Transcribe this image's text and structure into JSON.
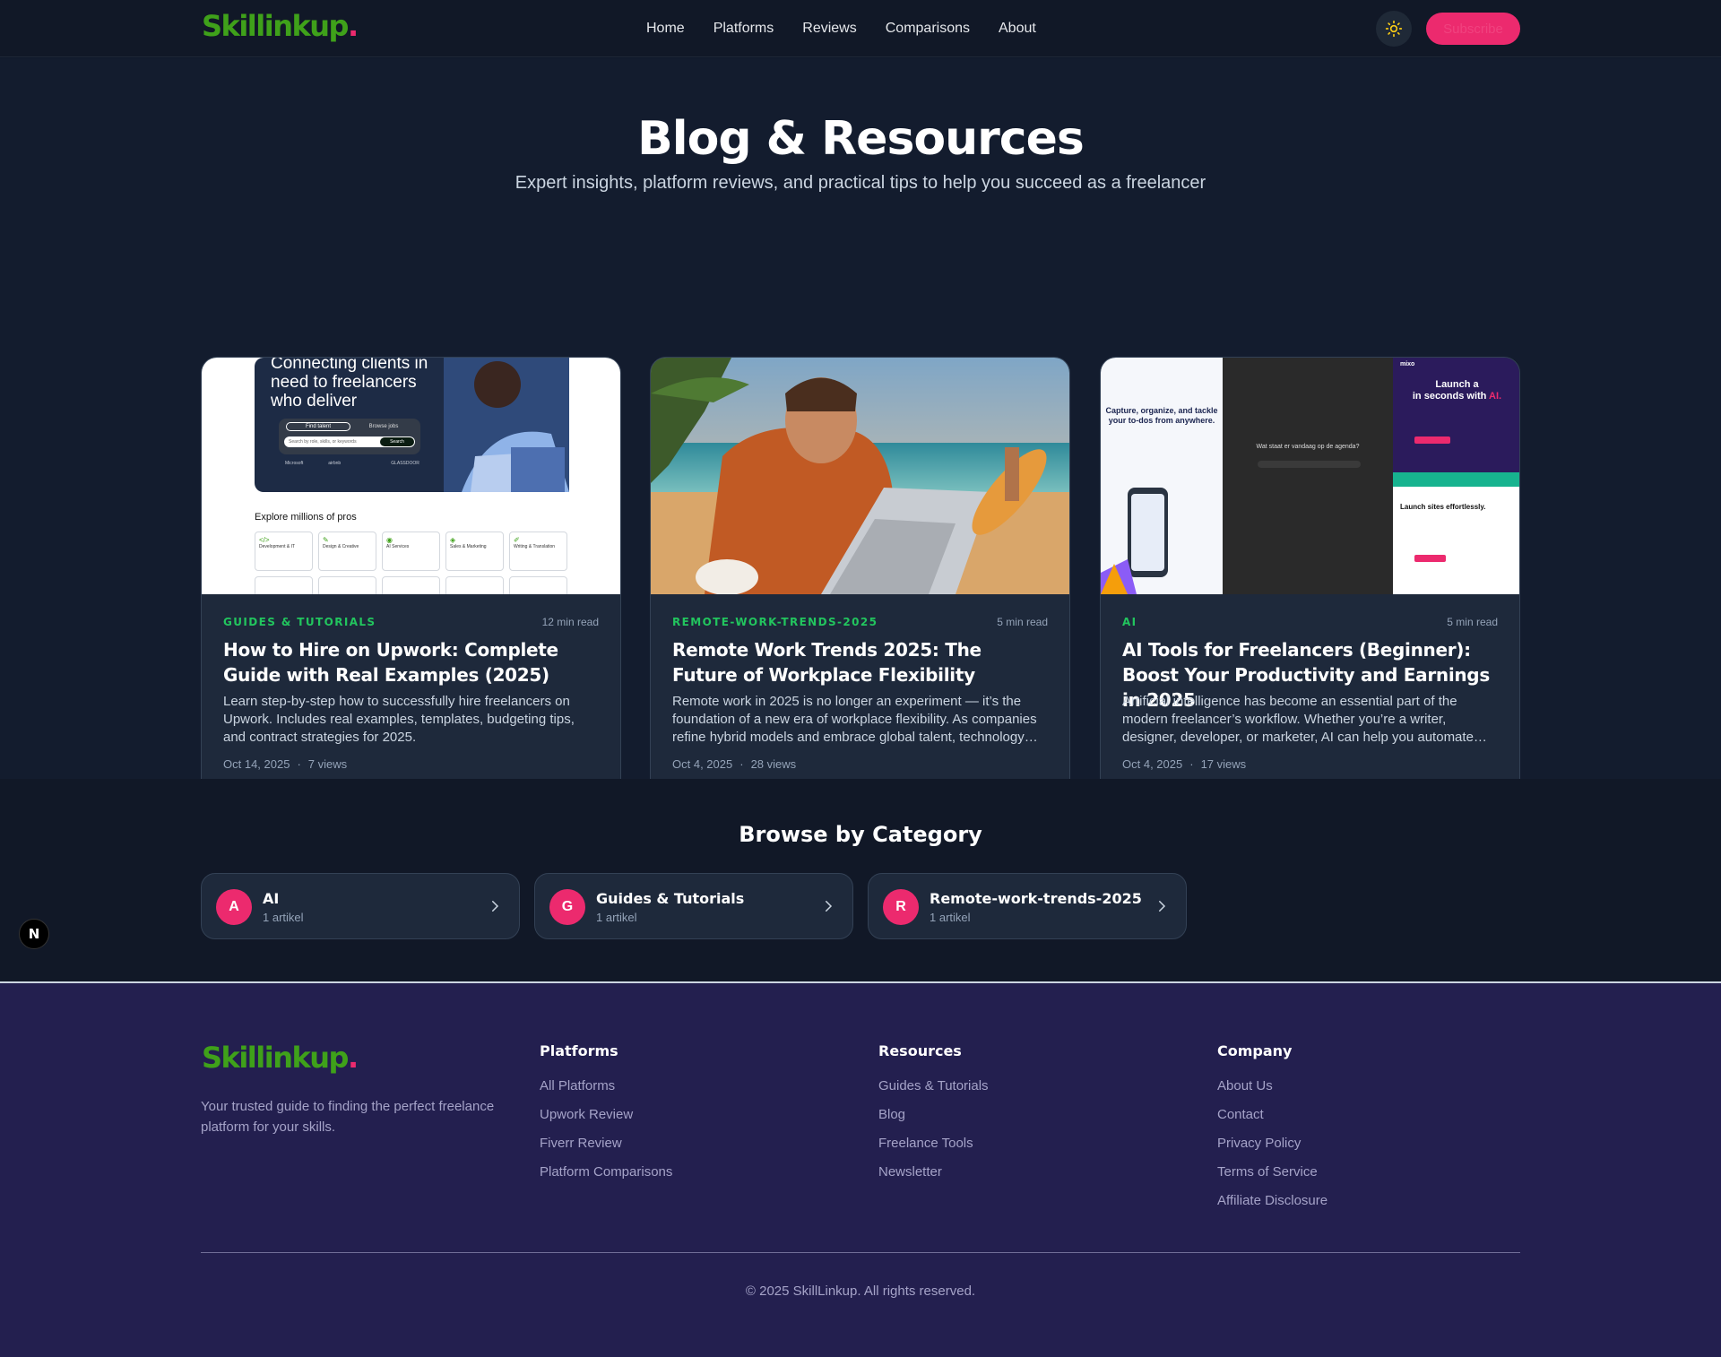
{
  "header": {
    "logo_text": "Skillinkup",
    "logo_dot": ".",
    "nav": [
      "Home",
      "Platforms",
      "Reviews",
      "Comparisons",
      "About"
    ],
    "theme_icon": "sun-icon",
    "subscribe_label": "Subscribe"
  },
  "hero": {
    "title": "Blog & Resources",
    "subtitle": "Expert insights, platform reviews, and practical tips to help you succeed as a freelancer"
  },
  "posts": [
    {
      "category": "GUIDES & TUTORIALS",
      "read_time": "12 min read",
      "title": "How to Hire on Upwork: Complete Guide with Real Examples (2025)",
      "excerpt": "Learn step-by-step how to successfully hire freelancers on Upwork. Includes real examples, templates, budgeting tips, and contract strategies for 2025.",
      "date": "Oct 14, 2025",
      "views": "7 views",
      "thumb": {
        "headline": "Connecting clients in need to freelancers who deliver",
        "tab_hire": "Find talent",
        "tab_browse": "Browse jobs",
        "search_placeholder": "Search by role, skills, or keywords",
        "search_button": "Search",
        "brands": [
          "Microsoft",
          "airbnb",
          "",
          "GLASSDOOR"
        ],
        "explore": "Explore millions of pros",
        "tiles": [
          "Development & IT",
          "Design & Creative",
          "AI Services",
          "Sales & Marketing",
          "Writing & Translation"
        ]
      }
    },
    {
      "category": "REMOTE-WORK-TRENDS-2025",
      "read_time": "5 min read",
      "title": "Remote Work Trends 2025: The Future of Workplace Flexibility",
      "excerpt": "Remote work in 2025 is no longer an experiment — it’s the foundation of a new era of workplace flexibility. As companies refine hybrid models and embrace global talent, technology…",
      "date": "Oct 4, 2025",
      "views": "28 views"
    },
    {
      "category": "AI",
      "read_time": "5 min read",
      "title": "AI Tools for Freelancers (Beginner): Boost Your Productivity and Earnings in 2025",
      "excerpt": "Artificial intelligence has become an essential part of the modern freelancer’s workflow. Whether you’re a writer, designer, developer, or marketer, AI can help you automate…",
      "date": "Oct 4, 2025",
      "views": "17 views",
      "thumb": {
        "panel1_headline": "Capture, organize, and tackle your to-dos from anywhere.",
        "panel2_prompt": "Wat staat er vandaag op de agenda?",
        "panel3_brand": "mixo",
        "panel3_headline": "Launch a",
        "panel3_headline2": "in seconds with",
        "panel3_ai": "AI.",
        "panel3_sub": "Launch sites effortlessly."
      }
    }
  ],
  "browse": {
    "title": "Browse by Category",
    "categories": [
      {
        "letter": "A",
        "name": "AI",
        "count": "1 artikel"
      },
      {
        "letter": "G",
        "name": "Guides & Tutorials",
        "count": "1 artikel"
      },
      {
        "letter": "R",
        "name": "Remote-work-trends-2025",
        "count": "1 artikel"
      }
    ]
  },
  "dev_badge": "N",
  "footer": {
    "logo_text": "Skillinkup",
    "logo_dot": ".",
    "tagline": "Your trusted guide to finding the perfect freelance platform for your skills.",
    "columns": [
      {
        "title": "Platforms",
        "links": [
          "All Platforms",
          "Upwork Review",
          "Fiverr Review",
          "Platform Comparisons"
        ]
      },
      {
        "title": "Resources",
        "links": [
          "Guides & Tutorials",
          "Blog",
          "Freelance Tools",
          "Newsletter"
        ]
      },
      {
        "title": "Company",
        "links": [
          "About Us",
          "Contact",
          "Privacy Policy",
          "Terms of Service",
          "Affiliate Disclosure"
        ]
      }
    ],
    "copyright": "© 2025 SkillLinkup. All rights reserved."
  },
  "colors": {
    "brand_green": "#3fa11a",
    "accent_pink": "#ec2a6e",
    "category_green": "#22c55e",
    "footer_bg": "#231f4f"
  }
}
